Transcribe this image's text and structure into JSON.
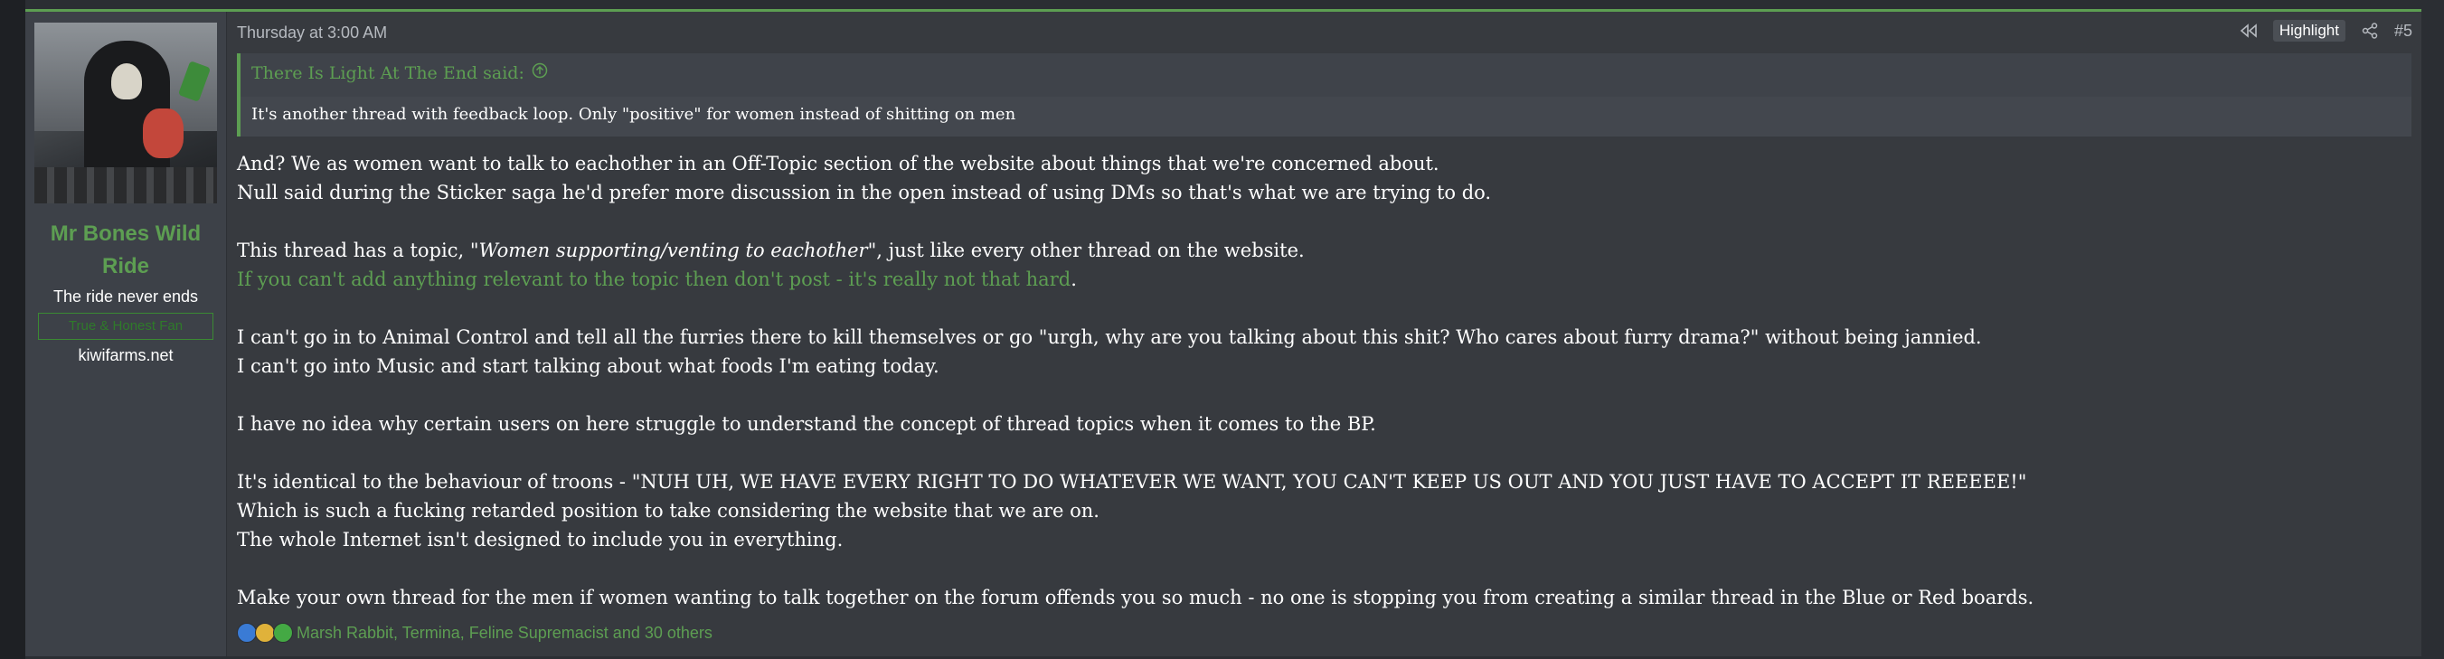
{
  "colors": {
    "accent": "#5d9e52",
    "background": "#2b2e33",
    "post_background": "#373a3f",
    "text": "#ffffff"
  },
  "user": {
    "name": "Mr Bones Wild Ride",
    "title": "The ride never ends",
    "badge": "True & Honest Fan",
    "site": "kiwifarms.net"
  },
  "post": {
    "date": "Thursday at 3:00 AM",
    "highlight_label": "Highlight",
    "number": "#5",
    "quote": {
      "author_line": "There Is Light At The End said:",
      "text": "It's another thread with feedback loop. Only \"positive\" for women instead of shitting on men"
    },
    "message": {
      "p1": "And? We as women want to talk to eachother in an Off-Topic section of the website about things that we're concerned about.",
      "p2": "Null said during the Sticker saga he'd prefer more discussion in the open instead of using DMs so that's what we are trying to do.",
      "p3_prefix": "This thread has a topic, \"",
      "p3_italic": "Women supporting/venting to eachother",
      "p3_suffix": "\", just like every other thread on the website.",
      "p4": "If you can't add anything relevant to the topic then don't post - it's really not that hard",
      "p4_end": ".",
      "p5": "I can't go in to Animal Control and tell all the furries there to kill themselves or go \"urgh, why are you talking about this shit? Who cares about furry drama?\" without being jannied.",
      "p6": "I can't go into Music and start talking about what foods I'm eating today.",
      "p7": "I have no idea why certain users on here struggle to understand the concept of thread topics when it comes to the BP.",
      "p8": "It's identical to the behaviour of troons - \"NUH UH, WE HAVE EVERY RIGHT TO DO WHATEVER WE WANT, YOU CAN'T KEEP US OUT AND YOU JUST HAVE TO ACCEPT IT REEEEE!\"",
      "p9": "Which is such a fucking retarded position to take considering the website that we are on.",
      "p10": "The whole Internet isn't designed to include you in everything.",
      "p11": "Make your own thread for the men if women wanting to talk together on the forum offends you so much - no one is stopping you from creating a similar thread in the Blue or Red boards."
    },
    "reactions": {
      "icons": [
        "like-icon",
        "winner-icon",
        "agree-icon"
      ],
      "text": "Marsh Rabbit, Termina, Feline Supremacist and 30 others"
    }
  }
}
